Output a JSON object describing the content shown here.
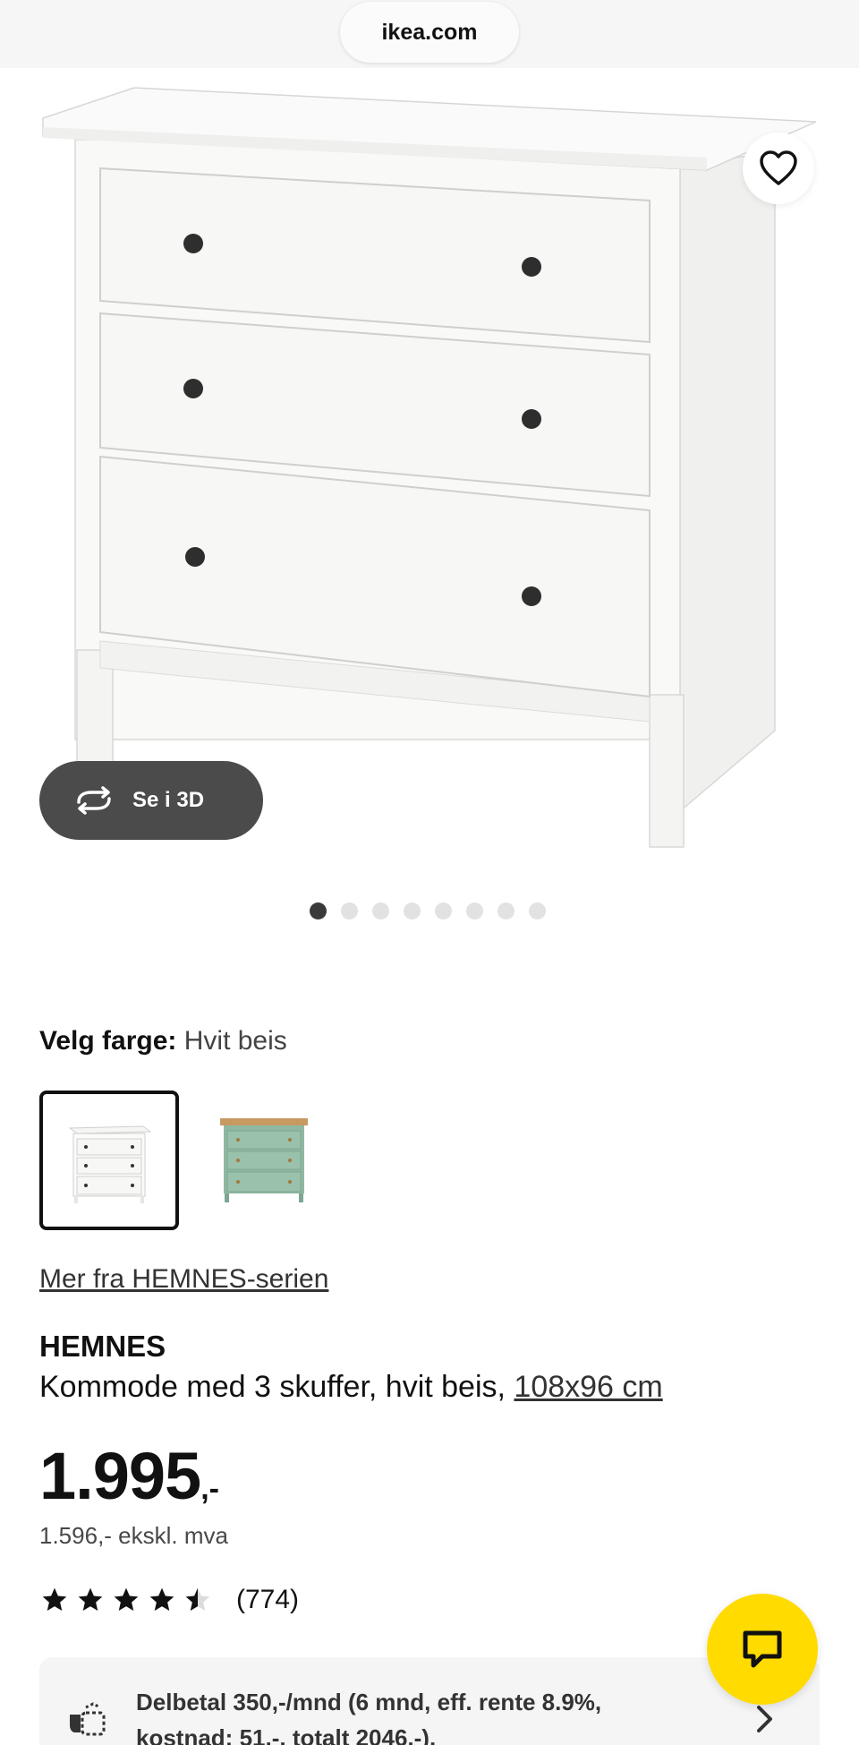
{
  "browser": {
    "url": "ikea.com"
  },
  "gallery": {
    "view3d_label": "Se i 3D",
    "dots_total": 8,
    "dots_active": 1
  },
  "color": {
    "label": "Velg farge:",
    "value": "Hvit beis",
    "swatches": [
      "white",
      "green"
    ]
  },
  "series_link": "Mer fra HEMNES-serien",
  "product": {
    "brand": "HEMNES",
    "description": "Kommode med 3 skuffer, hvit beis, ",
    "dimensions": "108x96 cm"
  },
  "price": {
    "amount": "1.995",
    "suffix": ",-",
    "excl_vat": "1.596,- ekskl. mva"
  },
  "rating": {
    "stars": 4.5,
    "count": "(774)"
  },
  "finance": {
    "text": "Delbetal 350,-/mnd (6 mnd, eff. rente 8.9%, kostnad: 51,-, totalt 2046,-)."
  },
  "colors": {
    "accent_yellow": "#ffdb00",
    "button_dark": "#4b4b4b",
    "swatch_green": "#8fb8a2"
  },
  "icons": [
    "heart-icon",
    "rotate-3d-icon",
    "star-icon",
    "chat-icon",
    "finance-icon",
    "chevron-right-icon"
  ]
}
